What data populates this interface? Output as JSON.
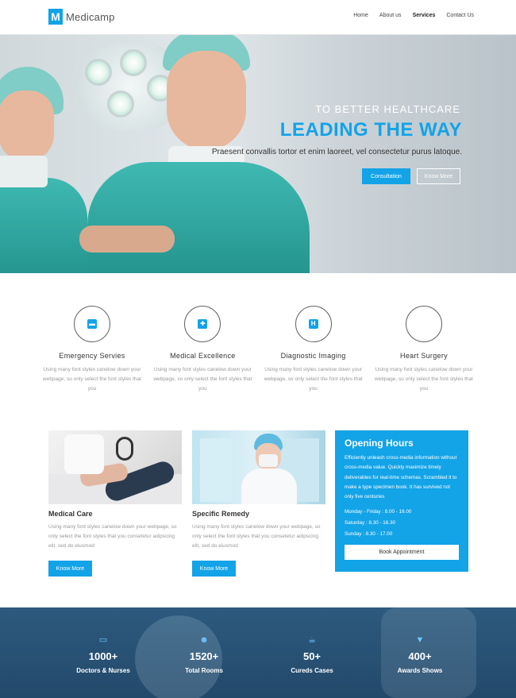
{
  "header": {
    "logo_mark": "M",
    "logo_text": "Medicamp",
    "nav": [
      {
        "label": "Home",
        "active": false
      },
      {
        "label": "About us",
        "active": false
      },
      {
        "label": "Services",
        "active": true
      },
      {
        "label": "Contact Us",
        "active": false
      }
    ]
  },
  "hero": {
    "eyebrow": "TO BETTER HEALTHCARE",
    "title": "LEADING THE WAY",
    "subtitle": "Praesent convallis tortor et enim laoreet, vel consectetur purus latoque.",
    "primary_button": "Consultation",
    "secondary_button": "Know More"
  },
  "features": [
    {
      "icon": "ambulance-icon",
      "glyph": "▬",
      "title": "Emergency Servies",
      "text": "Using many font styles canelow down your webpage, so only select the font styles that you"
    },
    {
      "icon": "medical-person-icon",
      "glyph": "✚",
      "title": "Medical Excellence",
      "text": "Using many font styles canelow down your webpage, so only select the font styles that you"
    },
    {
      "icon": "hospital-icon",
      "glyph": "H",
      "title": "Diagnostic Imaging",
      "text": "Using many font styles canelow down your webpage, so only select the font styles that you"
    },
    {
      "icon": "heart-icon",
      "glyph": "",
      "title": "Heart Surgery",
      "text": "Using many font styles canelow down your webpage, so only select the font styles that you"
    }
  ],
  "services": [
    {
      "title": "Medical Care",
      "text": "Using many font styles canelow down your webpage, so only select the font styles that you consetetur adipscing elit, sed do eiusmod",
      "button": "Know More"
    },
    {
      "title": "Specific Remedy",
      "text": "Using many font styles canelow down your webpage, so only select the font styles that you consetetur adipscing elit, sed do eiusmod",
      "button": "Know More"
    }
  ],
  "hours": {
    "title": "Opening Hours",
    "text": "Efficiently unleash cross-media information without cross-media value. Quickly maximize timely deliverables for real-time schemas. Scrambled it to make a type specimen book. It has survived not only five centuries",
    "rows": [
      "Monday - Friday : 8.00 - 16.00",
      "Saturday : 8.30 - 16.30",
      "Sunday : 8.30 - 17.00"
    ],
    "button": "Book Appointment"
  },
  "stats": [
    {
      "icon": "monitor-icon",
      "glyph": "▭",
      "number": "1000+",
      "label": "Doctors & Nurses"
    },
    {
      "icon": "users-icon",
      "glyph": "☻",
      "number": "1520+",
      "label": "Total Rooms"
    },
    {
      "icon": "coffee-cup-icon",
      "glyph": "☕",
      "number": "50+",
      "label": "Cureds Cases"
    },
    {
      "icon": "trophy-icon",
      "glyph": "▼",
      "number": "400+",
      "label": "Awards Shows"
    }
  ],
  "colors": {
    "accent": "#13a3e7",
    "stats_bg": "#2d5a7f"
  }
}
